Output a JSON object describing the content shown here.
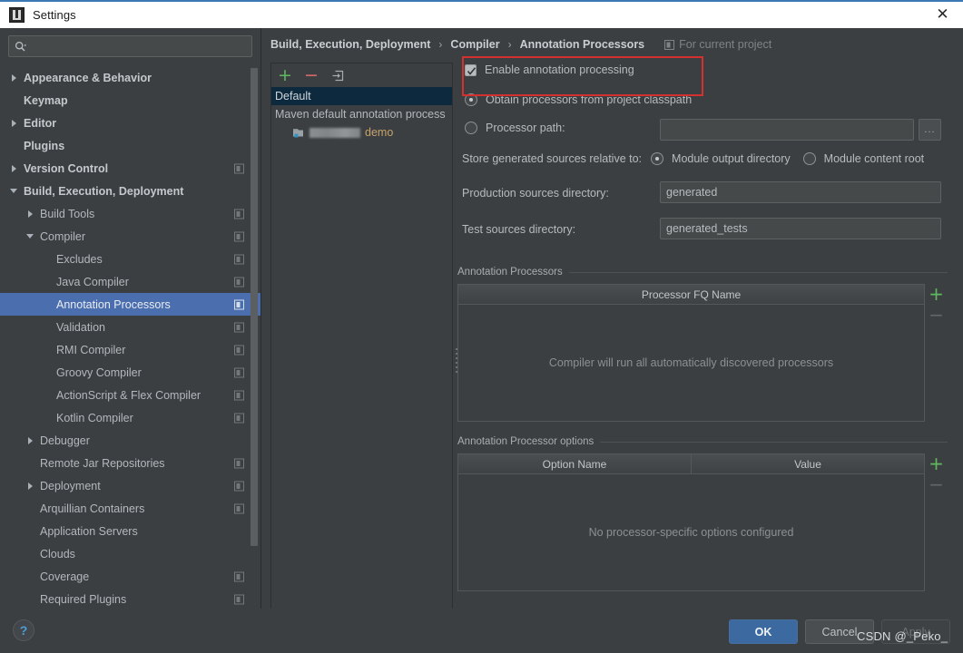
{
  "window": {
    "title": "Settings",
    "app_icon": "intellij-idea-icon",
    "close_icon": "close-icon"
  },
  "sidebar": {
    "search": {
      "placeholder": "",
      "value": "",
      "icon": "search-icon"
    },
    "items": [
      {
        "label": "Appearance & Behavior",
        "indent": 0,
        "expander": "right",
        "bold": true,
        "project_icon": false
      },
      {
        "label": "Keymap",
        "indent": 0,
        "expander": "none",
        "bold": true,
        "project_icon": false
      },
      {
        "label": "Editor",
        "indent": 0,
        "expander": "right",
        "bold": true,
        "project_icon": false
      },
      {
        "label": "Plugins",
        "indent": 0,
        "expander": "none",
        "bold": true,
        "project_icon": false
      },
      {
        "label": "Version Control",
        "indent": 0,
        "expander": "right",
        "bold": true,
        "project_icon": true
      },
      {
        "label": "Build, Execution, Deployment",
        "indent": 0,
        "expander": "down",
        "bold": true,
        "project_icon": false
      },
      {
        "label": "Build Tools",
        "indent": 1,
        "expander": "right",
        "bold": false,
        "project_icon": true
      },
      {
        "label": "Compiler",
        "indent": 1,
        "expander": "down",
        "bold": false,
        "project_icon": true
      },
      {
        "label": "Excludes",
        "indent": 2,
        "expander": "none",
        "bold": false,
        "project_icon": true
      },
      {
        "label": "Java Compiler",
        "indent": 2,
        "expander": "none",
        "bold": false,
        "project_icon": true
      },
      {
        "label": "Annotation Processors",
        "indent": 2,
        "expander": "none",
        "bold": false,
        "project_icon": true,
        "selected": true
      },
      {
        "label": "Validation",
        "indent": 2,
        "expander": "none",
        "bold": false,
        "project_icon": true
      },
      {
        "label": "RMI Compiler",
        "indent": 2,
        "expander": "none",
        "bold": false,
        "project_icon": true
      },
      {
        "label": "Groovy Compiler",
        "indent": 2,
        "expander": "none",
        "bold": false,
        "project_icon": true
      },
      {
        "label": "ActionScript & Flex Compiler",
        "indent": 2,
        "expander": "none",
        "bold": false,
        "project_icon": true
      },
      {
        "label": "Kotlin Compiler",
        "indent": 2,
        "expander": "none",
        "bold": false,
        "project_icon": true
      },
      {
        "label": "Debugger",
        "indent": 1,
        "expander": "right",
        "bold": false,
        "project_icon": false
      },
      {
        "label": "Remote Jar Repositories",
        "indent": 1,
        "expander": "none",
        "bold": false,
        "project_icon": true
      },
      {
        "label": "Deployment",
        "indent": 1,
        "expander": "right",
        "bold": false,
        "project_icon": true
      },
      {
        "label": "Arquillian Containers",
        "indent": 1,
        "expander": "none",
        "bold": false,
        "project_icon": true
      },
      {
        "label": "Application Servers",
        "indent": 1,
        "expander": "none",
        "bold": false,
        "project_icon": false
      },
      {
        "label": "Clouds",
        "indent": 1,
        "expander": "none",
        "bold": false,
        "project_icon": false
      },
      {
        "label": "Coverage",
        "indent": 1,
        "expander": "none",
        "bold": false,
        "project_icon": true
      },
      {
        "label": "Required Plugins",
        "indent": 1,
        "expander": "none",
        "bold": false,
        "project_icon": true
      }
    ]
  },
  "header": {
    "crumbs": [
      "Build, Execution, Deployment",
      "Compiler",
      "Annotation Processors"
    ],
    "separator": "›",
    "scope_label": "For current project",
    "scope_icon": "project-scope-icon"
  },
  "profiles": {
    "toolbar": {
      "add_label": "+",
      "remove_label": "−",
      "move_icon": "move-to-profile-icon"
    },
    "rows": [
      {
        "label": "Default",
        "type": "profile",
        "selected": true
      },
      {
        "label": "Maven default annotation process",
        "type": "profile",
        "selected": false
      },
      {
        "label": "demo",
        "type": "module",
        "icon": "module-icon",
        "redacted": true,
        "selected": false
      }
    ]
  },
  "settings": {
    "enable_annotation_processing": {
      "label": "Enable annotation processing",
      "checked": true
    },
    "processor_source": {
      "selected": "classpath",
      "options": [
        {
          "id": "classpath",
          "label": "Obtain processors from project classpath"
        },
        {
          "id": "path",
          "label": "Processor path:"
        }
      ]
    },
    "processor_path": {
      "value": "",
      "browse_label": "..."
    },
    "store_relative": {
      "label": "Store generated sources relative to:",
      "selected": "module_output",
      "options": [
        {
          "id": "module_output",
          "label": "Module output directory"
        },
        {
          "id": "content_root",
          "label": "Module content root"
        }
      ]
    },
    "production_sources": {
      "label": "Production sources directory:",
      "value": "generated"
    },
    "test_sources": {
      "label": "Test sources directory:",
      "value": "generated_tests"
    }
  },
  "processors_table": {
    "group_title": "Annotation Processors",
    "columns": [
      "Processor FQ Name"
    ],
    "rows": [],
    "empty_text": "Compiler will run all automatically discovered processors",
    "add_label": "+",
    "remove_label": "−"
  },
  "options_table": {
    "group_title": "Annotation Processor options",
    "columns": [
      "Option Name",
      "Value"
    ],
    "rows": [],
    "empty_text": "No processor-specific options configured",
    "add_label": "+",
    "remove_label": "−"
  },
  "footer": {
    "help_label": "?",
    "ok_label": "OK",
    "cancel_label": "Cancel",
    "apply_label": "Apply",
    "watermark": "CSDN @_Peko_"
  },
  "colors": {
    "accent_blue": "#4b6eaf",
    "ok_button": "#3c699f",
    "annotation_red": "#d53030",
    "add_green": "#5fb85f",
    "remove_red": "#d96a6a",
    "module_name": "#c7a26b",
    "background": "#3c3f41"
  }
}
